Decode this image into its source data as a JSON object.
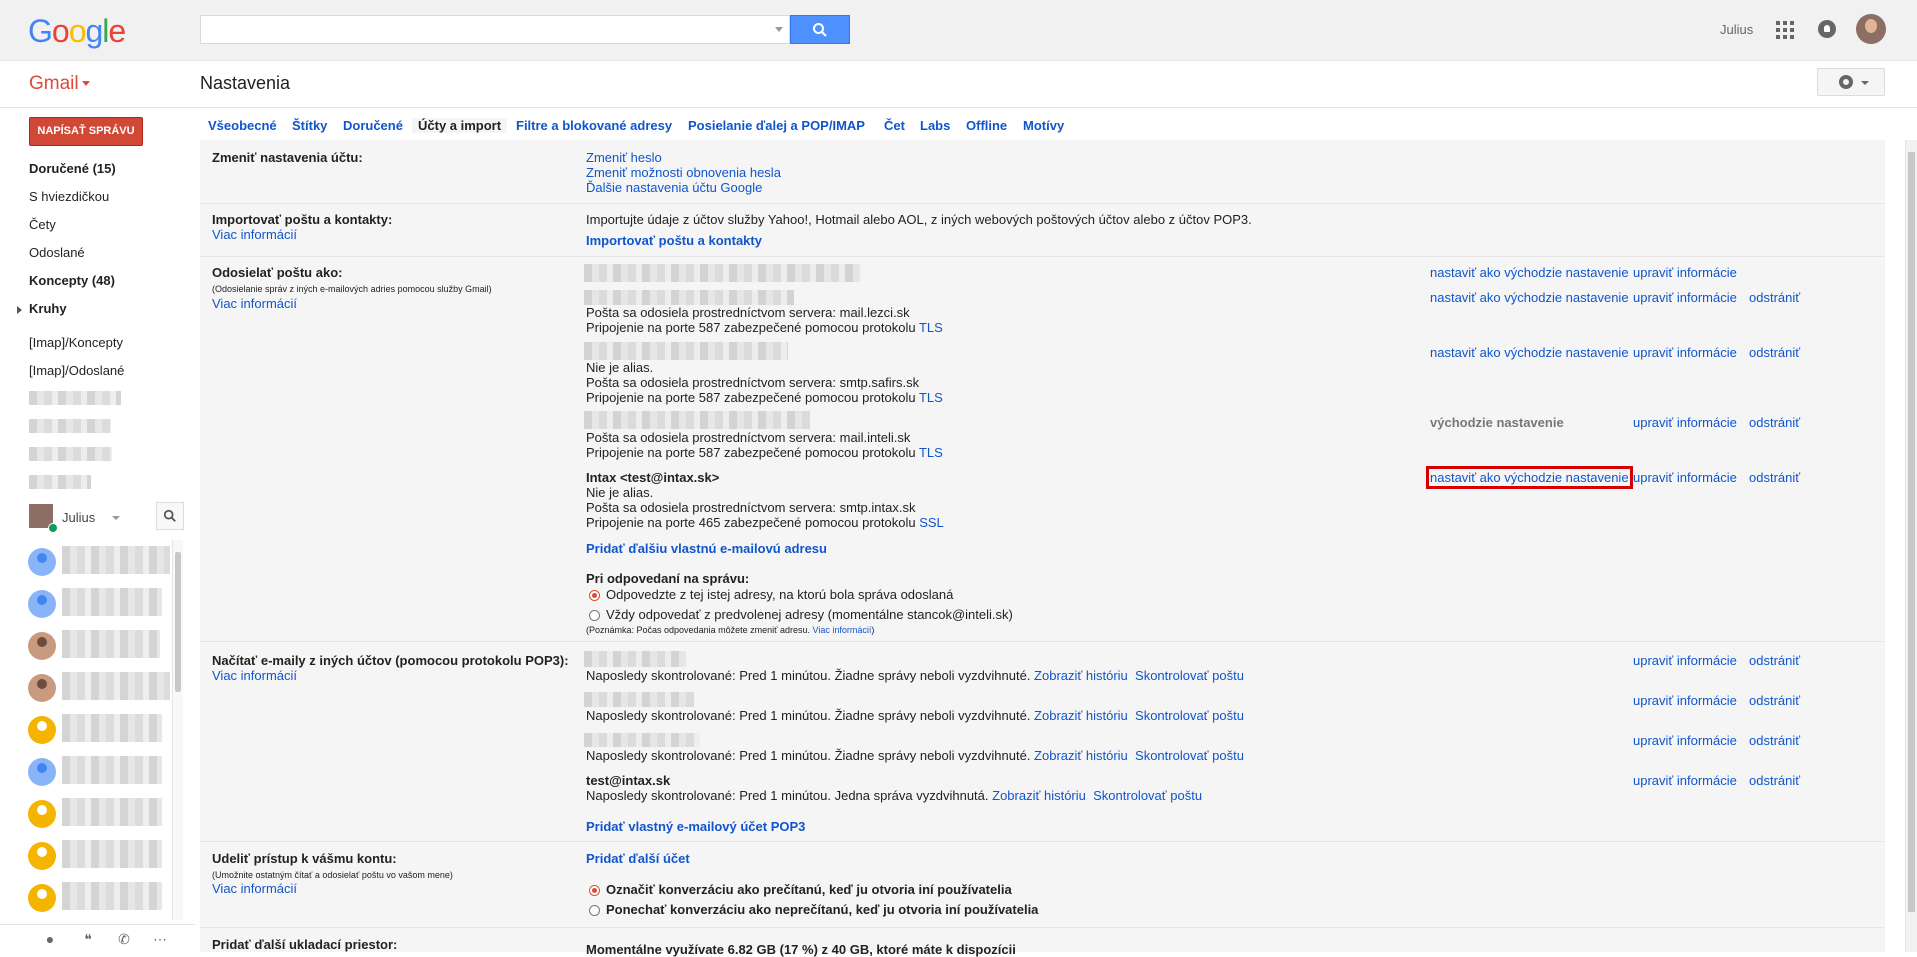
{
  "logo": {
    "letters": [
      [
        "G",
        "#4285f4"
      ],
      [
        "o",
        "#ea4335"
      ],
      [
        "o",
        "#fbbc05"
      ],
      [
        "g",
        "#4285f4"
      ],
      [
        "l",
        "#34a853"
      ],
      [
        "e",
        "#ea4335"
      ]
    ]
  },
  "header": {
    "user_name": "Julius",
    "app_name": "Gmail",
    "page_title": "Nastavenia"
  },
  "sidebar": {
    "compose_label": "NAPÍSAŤ SPRÁVU",
    "items": [
      {
        "label": "Doručené (15)",
        "bold": true
      },
      {
        "label": "S hviezdičkou",
        "bold": false
      },
      {
        "label": "Čety",
        "bold": false
      },
      {
        "label": "Odoslané",
        "bold": false
      },
      {
        "label": "Koncepty (48)",
        "bold": true
      },
      {
        "label": "Kruhy",
        "bold": true
      },
      {
        "label": "[Imap]/Koncepty",
        "bold": false
      },
      {
        "label": "[Imap]/Odoslané",
        "bold": false
      }
    ],
    "chat_user": "Julius"
  },
  "tabs": [
    {
      "label": "Všeobecné"
    },
    {
      "label": "Štítky"
    },
    {
      "label": "Doručené"
    },
    {
      "label": "Účty a import",
      "active": true
    },
    {
      "label": "Filtre a blokované adresy"
    },
    {
      "label": "Posielanie ďalej a POP/IMAP"
    },
    {
      "label": "Čet"
    },
    {
      "label": "Labs"
    },
    {
      "label": "Offline"
    },
    {
      "label": "Motívy"
    }
  ],
  "settings": {
    "change_account": {
      "label": "Zmeniť nastavenia účtu:",
      "links": [
        "Zmeniť heslo",
        "Zmeniť možnosti obnovenia hesla",
        "Ďalšie nastavenia účtu Google"
      ]
    },
    "import": {
      "label": "Importovať poštu a kontakty:",
      "more": "Viac informácií",
      "desc": "Importujte údaje z účtov služby Yahoo!, Hotmail alebo AOL, z iných webových poštových účtov alebo z účtov POP3.",
      "action": "Importovať poštu a kontakty"
    },
    "send_as": {
      "label": "Odosielať poštu ako:",
      "note": "(Odosielanie správ z iných e-mailových adries pomocou služby Gmail)",
      "more": "Viac informácií",
      "set_default": "nastaviť ako východzie nastavenie",
      "is_default": "východzie nastavenie",
      "edit": "upraviť informácie",
      "remove": "odstrániť",
      "acc2": {
        "server": "Pošta sa odosiela prostredníctvom servera: mail.lezci.sk",
        "port": "Pripojenie na porte 587 zabezpečené pomocou protokolu",
        "proto": "TLS"
      },
      "acc3": {
        "alias": "Nie je alias.",
        "server": "Pošta sa odosiela prostredníctvom servera: smtp.safirs.sk",
        "port": "Pripojenie na porte 587 zabezpečené pomocou protokolu",
        "proto": "TLS"
      },
      "acc4": {
        "server": "Pošta sa odosiela prostredníctvom servera: mail.inteli.sk",
        "port": "Pripojenie na porte 587 zabezpečené pomocou protokolu",
        "proto": "TLS"
      },
      "acc5": {
        "name": "Intax <test@intax.sk>",
        "alias": "Nie je alias.",
        "server": "Pošta sa odosiela prostredníctvom servera: smtp.intax.sk",
        "port": "Pripojenie na porte 465 zabezpečené pomocou protokolu",
        "proto": "SSL"
      },
      "add": "Pridať ďalšiu vlastnú e-mailovú adresu",
      "reply_label": "Pri odpovedaní na správu:",
      "reply_opt1": "Odpovedzte z tej istej adresy, na ktorú bola správa odoslaná",
      "reply_opt2": "Vždy odpovedať z predvolenej adresy (momentálne stancok@inteli.sk)",
      "reply_note": "(Poznámka: Počas odpovedania môžete zmeniť adresu.",
      "reply_more": "Viac informácií",
      "reply_note_end": ")"
    },
    "pop3": {
      "label": "Načítať e-maily z iných účtov (pomocou protokolu POP3):",
      "more": "Viac informácií",
      "status_none": "Naposledy skontrolované: Pred 1 minútou. Žiadne správy neboli vyzdvihnuté.",
      "status_one": "Naposledy skontrolované: Pred 1 minútou. Jedna správa vyzdvihnutá.",
      "history": "Zobraziť históriu",
      "check": "Skontrolovať poštu",
      "acc4_name": "test@intax.sk",
      "add": "Pridať vlastný e-mailový účet POP3"
    },
    "grant": {
      "label": "Udeliť prístup k vášmu kontu:",
      "note": "(Umožnite ostatným čítať a odosielať poštu vo vašom mene)",
      "more": "Viac informácií",
      "add": "Pridať ďalší účet",
      "opt1": "Označiť konverzáciu ako prečítanú, keď ju otvoria iní používatelia",
      "opt2": "Ponechať konverzáciu ako neprečítanú, keď ju otvoria iní používatelia"
    },
    "storage": {
      "label": "Pridať ďalší ukladací priestor:",
      "usage": "Momentálne využívate 6.82 GB (17 %) z 40 GB, ktoré máte k dispozícii"
    }
  }
}
